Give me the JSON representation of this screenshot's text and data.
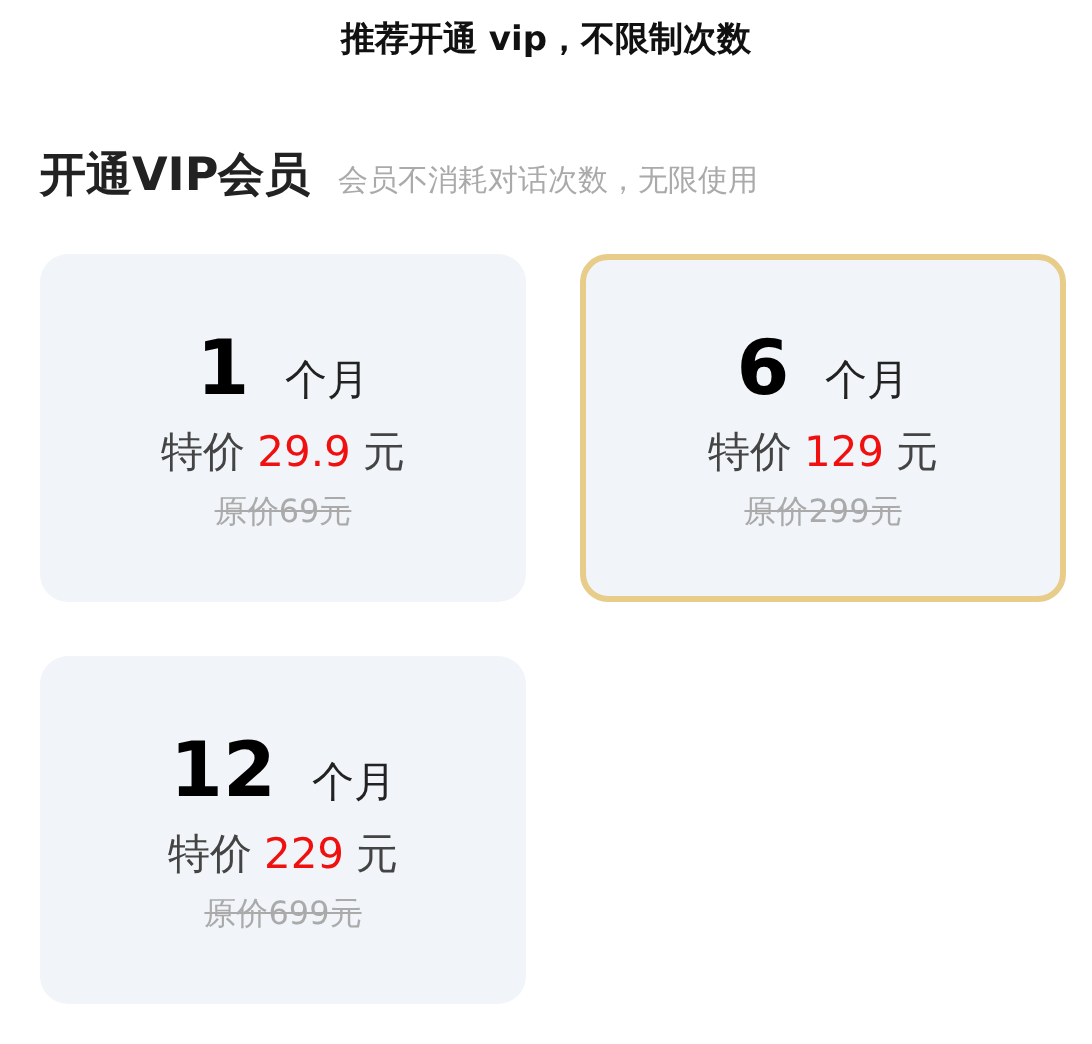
{
  "banner": "推荐开通 vip，不限制次数",
  "heading": {
    "title": "开通VIP会员",
    "subtitle": "会员不消耗对话次数，无限使用"
  },
  "plans": [
    {
      "months": "1",
      "unit": "个月",
      "price_label": "特价",
      "price": "29.9",
      "currency": "元",
      "original_price": "原价69元",
      "selected": false
    },
    {
      "months": "6",
      "unit": "个月",
      "price_label": "特价",
      "price": "129",
      "currency": "元",
      "original_price": "原价299元",
      "selected": true
    },
    {
      "months": "12",
      "unit": "个月",
      "price_label": "特价",
      "price": "229",
      "currency": "元",
      "original_price": "原价699元",
      "selected": false
    }
  ]
}
